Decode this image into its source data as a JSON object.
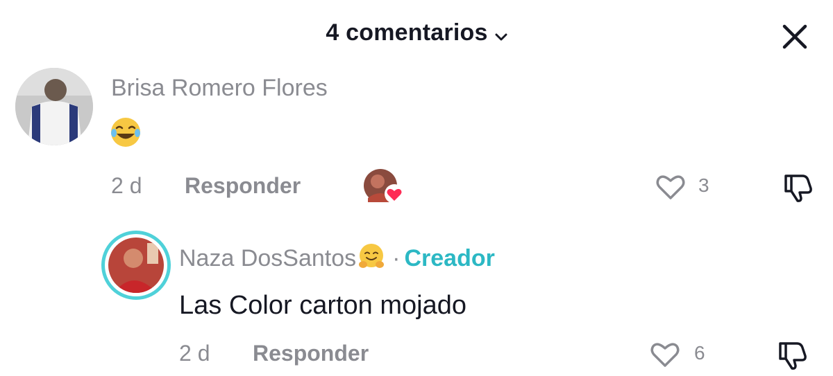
{
  "header": {
    "title": "4 comentarios",
    "chevron_icon": "chevron-down-icon",
    "close_icon": "close-icon"
  },
  "comments": [
    {
      "username": "Brisa Romero Flores",
      "avatar_icon": "user-avatar",
      "emoji": "face-with-tears-of-joy",
      "time": "2 d",
      "reply_label": "Responder",
      "creator_liked": true,
      "likes": "3",
      "like_icon": "heart-outline-icon",
      "dislike_icon": "thumbs-down-icon"
    },
    {
      "username": "Naza DosSantos",
      "username_emoji": "hugging-face",
      "separator": "·",
      "badge": "Creador",
      "text": "Las Color carton mojado",
      "time": "2 d",
      "reply_label": "Responder",
      "likes": "6",
      "like_icon": "heart-outline-icon",
      "dislike_icon": "thumbs-down-icon"
    }
  ],
  "colors": {
    "text_primary": "#161823",
    "text_secondary": "#8a8b91",
    "creator_badge": "#2cb8c4",
    "avatar_ring": "#4fd1d9",
    "heart_badge": "#fe2c55"
  }
}
